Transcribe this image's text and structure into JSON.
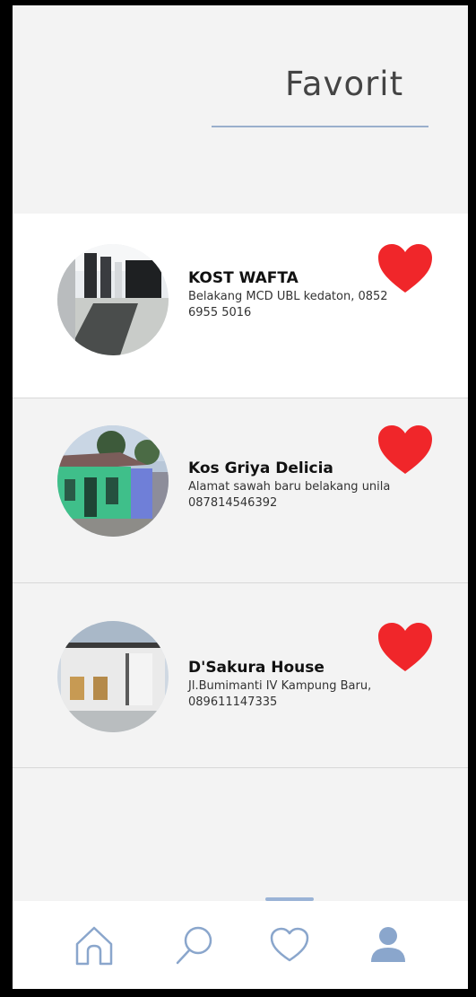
{
  "header": {
    "title": "Favorit"
  },
  "favorites": [
    {
      "name": "KOST WAFTA",
      "address": "Belakang MCD UBL kedaton, 0852 6955 5016"
    },
    {
      "name": "Kos Griya Delicia",
      "address": "Alamat sawah baru belakang unila 087814546392"
    },
    {
      "name": "D'Sakura House",
      "address": "Jl.Bumimanti IV Kampung Baru, 089611147335"
    }
  ],
  "colors": {
    "heart": "#f0262a",
    "accent": "#9ab3d6",
    "nav_icon": "#8aa6cc"
  },
  "nav": {
    "items": [
      {
        "icon": "home-icon"
      },
      {
        "icon": "search-icon"
      },
      {
        "icon": "heart-outline-icon",
        "active": true
      },
      {
        "icon": "profile-icon"
      }
    ]
  }
}
